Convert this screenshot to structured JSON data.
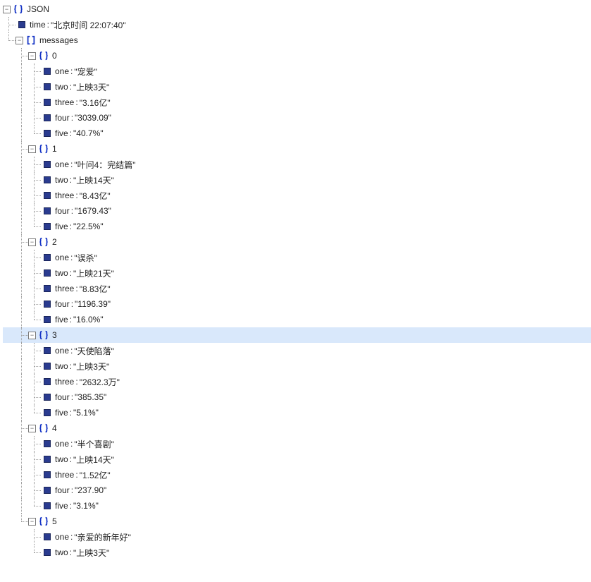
{
  "root_label": "JSON",
  "toggle_minus": "−",
  "time_key": "time",
  "time_val": "\"北京时间 22:07:40\"",
  "messages_key": "messages",
  "sep": " : ",
  "highlight_index": 3,
  "items": [
    {
      "idx": "0",
      "pairs": [
        {
          "k": "one",
          "v": "\"宠爱\""
        },
        {
          "k": "two",
          "v": "\"上映3天\""
        },
        {
          "k": "three",
          "v": "\"3.16亿\""
        },
        {
          "k": "four",
          "v": "\"3039.09\""
        },
        {
          "k": "five",
          "v": "\"40.7%\""
        }
      ]
    },
    {
      "idx": "1",
      "pairs": [
        {
          "k": "one",
          "v": "\"叶问4：完结篇\""
        },
        {
          "k": "two",
          "v": "\"上映14天\""
        },
        {
          "k": "three",
          "v": "\"8.43亿\""
        },
        {
          "k": "four",
          "v": "\"1679.43\""
        },
        {
          "k": "five",
          "v": "\"22.5%\""
        }
      ]
    },
    {
      "idx": "2",
      "pairs": [
        {
          "k": "one",
          "v": "\"误杀\""
        },
        {
          "k": "two",
          "v": "\"上映21天\""
        },
        {
          "k": "three",
          "v": "\"8.83亿\""
        },
        {
          "k": "four",
          "v": "\"1196.39\""
        },
        {
          "k": "five",
          "v": "\"16.0%\""
        }
      ]
    },
    {
      "idx": "3",
      "pairs": [
        {
          "k": "one",
          "v": "\"天使陷落\""
        },
        {
          "k": "two",
          "v": "\"上映3天\""
        },
        {
          "k": "three",
          "v": "\"2632.3万\""
        },
        {
          "k": "four",
          "v": "\"385.35\""
        },
        {
          "k": "five",
          "v": "\"5.1%\""
        }
      ]
    },
    {
      "idx": "4",
      "pairs": [
        {
          "k": "one",
          "v": "\"半个喜剧\""
        },
        {
          "k": "two",
          "v": "\"上映14天\""
        },
        {
          "k": "three",
          "v": "\"1.52亿\""
        },
        {
          "k": "four",
          "v": "\"237.90\""
        },
        {
          "k": "five",
          "v": "\"3.1%\""
        }
      ]
    },
    {
      "idx": "5",
      "pairs": [
        {
          "k": "one",
          "v": "\"亲爱的新年好\""
        },
        {
          "k": "two",
          "v": "\"上映3天\""
        }
      ]
    }
  ]
}
